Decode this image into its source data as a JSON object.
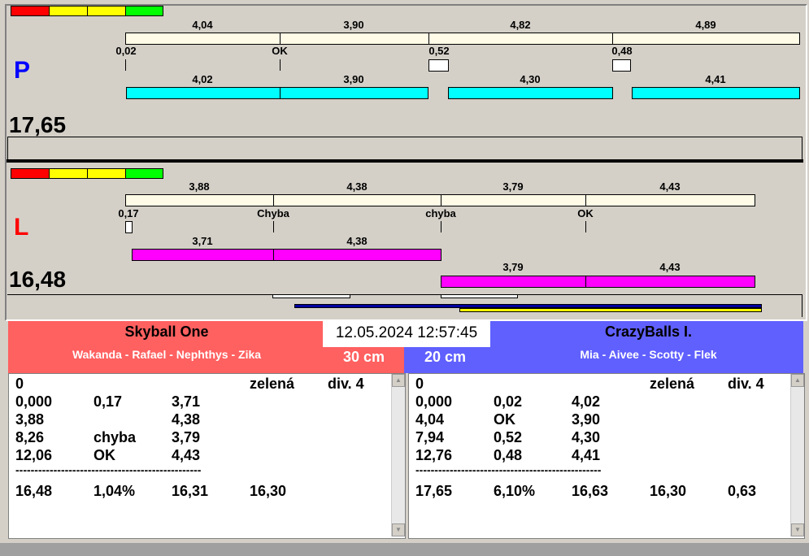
{
  "colors": {
    "red": "#ff0000",
    "yellow": "#ffff00",
    "green": "#00ff00",
    "cream": "#fffbe6",
    "cyan": "#00ffff",
    "magenta": "#ff00ff",
    "left_team": "#ff6060",
    "right_team": "#6060ff"
  },
  "p_panel": {
    "side": "P",
    "total": "17,65",
    "top_labels": [
      "4,04",
      "3,90",
      "4,82",
      "4,89"
    ],
    "tick_labels": [
      "0,02",
      "OK",
      "0,52",
      "0,48"
    ],
    "bottom_labels": [
      "4,02",
      "3,90",
      "4,30",
      "4,41"
    ]
  },
  "l_panel": {
    "side": "L",
    "total": "16,48",
    "top_labels": [
      "3,88",
      "4,38",
      "3,79",
      "4,43"
    ],
    "tick_labels": [
      "0,17",
      "Chyba",
      "chyba",
      "OK"
    ],
    "bottom_labels": [
      "3,71",
      "4,38"
    ],
    "bottom2_labels": [
      "3,79",
      "4,43"
    ]
  },
  "datetime": "12.05.2024 12:57:45",
  "left_team": {
    "name": "Skyball One",
    "members": "Wakanda - Rafael - Nephthys - Zika",
    "distance": "30 cm",
    "rows": [
      [
        "0",
        "",
        "",
        "zelená",
        "div. 4"
      ],
      [
        "0,000",
        "0,17",
        "3,71",
        "",
        ""
      ],
      [
        "3,88",
        "",
        "4,38",
        "",
        ""
      ],
      [
        "8,26",
        "chyba",
        "3,79",
        "",
        ""
      ],
      [
        "12,06",
        "OK",
        "4,43",
        "",
        ""
      ]
    ],
    "separator": "-------------------------------------------------",
    "summary": [
      "16,48",
      "1,04%",
      "16,31",
      "16,30",
      ""
    ]
  },
  "right_team": {
    "name": "CrazyBalls I.",
    "members": "Mia - Aivee - Scotty - Flek",
    "distance": "20 cm",
    "rows": [
      [
        "0",
        "",
        "",
        "zelená",
        "div. 4"
      ],
      [
        "0,000",
        "0,02",
        "4,02",
        "",
        ""
      ],
      [
        "4,04",
        "OK",
        "3,90",
        "",
        ""
      ],
      [
        "7,94",
        "0,52",
        "4,30",
        "",
        ""
      ],
      [
        "12,76",
        "0,48",
        "4,41",
        "",
        ""
      ]
    ],
    "separator": "-------------------------------------------------",
    "summary": [
      "17,65",
      "6,10%",
      "16,63",
      "16,30",
      "0,63"
    ]
  }
}
